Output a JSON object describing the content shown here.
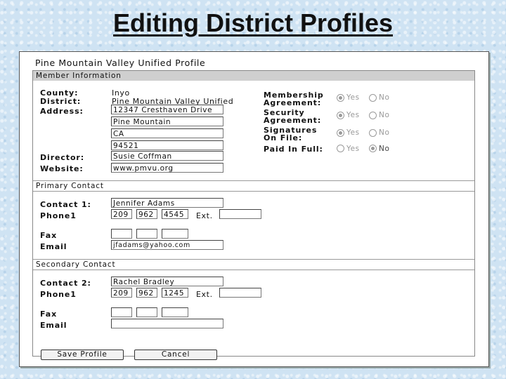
{
  "slide_title": "Editing District Profiles",
  "window": {
    "title": "Pine Mountain Valley Unified Profile"
  },
  "member": {
    "heading": "Member Information",
    "county_label": "County:",
    "county": "Inyo",
    "district_label": "District:",
    "district": "Pine Mountain Valley Unified",
    "address_label": "Address:",
    "address1": "12347 Cresthaven Drive",
    "city": "Pine Mountain",
    "state": "CA",
    "zip": "94521",
    "director_label": "Director:",
    "director": "Susie Coffman",
    "website_label": "Website:",
    "website": "www.pmvu.org",
    "membership_label_1": "Membership",
    "membership_label_2": "Agreement:",
    "security_label_1": "Security",
    "security_label_2": "Agreement:",
    "signatures_label_1": "Signatures",
    "signatures_label_2": "On File:",
    "paid_label": "Paid In Full:",
    "yes": "Yes",
    "no": "No"
  },
  "primary": {
    "heading": "Primary Contact",
    "contact_label": "Contact 1:",
    "contact": "Jennifer Adams",
    "phone_label": "Phone1",
    "area": "209",
    "prefix": "962",
    "line": "4545",
    "ext_label": "Ext.",
    "ext": "",
    "fax_label": "Fax",
    "email_label": "Email",
    "email": "jfadams@yahoo.com"
  },
  "secondary": {
    "heading": "Secondary Contact",
    "contact_label": "Contact 2:",
    "contact": "Rachel Bradley",
    "phone_label": "Phone1",
    "area": "209",
    "prefix": "962",
    "line": "1245",
    "ext_label": "Ext.",
    "ext": "",
    "fax_label": "Fax",
    "email_label": "Email",
    "email": ""
  },
  "buttons": {
    "save": "Save Profile",
    "cancel": "Cancel"
  },
  "radio_state": {
    "membership": "yes",
    "security": "yes",
    "signatures": "yes",
    "paid_in_full": "no"
  }
}
